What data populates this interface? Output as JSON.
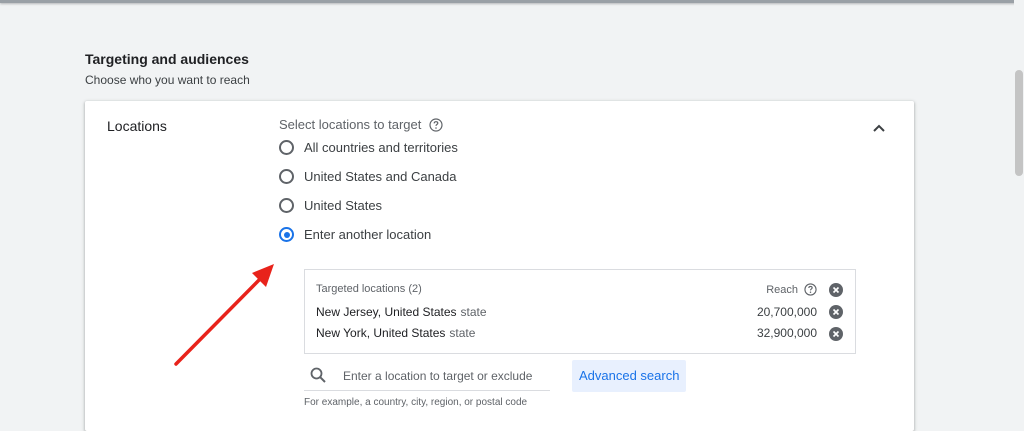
{
  "section": {
    "title": "Targeting and audiences",
    "subtitle": "Choose who you want to reach"
  },
  "locations": {
    "label": "Locations",
    "select_label": "Select locations to target",
    "options": [
      {
        "label": "All countries and territories",
        "selected": false
      },
      {
        "label": "United States and Canada",
        "selected": false
      },
      {
        "label": "United States",
        "selected": false
      },
      {
        "label": "Enter another location",
        "selected": true
      }
    ],
    "targeted": {
      "header": "Targeted locations (2)",
      "reach_header": "Reach",
      "rows": [
        {
          "name": "New Jersey, United States",
          "type": "state",
          "reach": "20,700,000"
        },
        {
          "name": "New York, United States",
          "type": "state",
          "reach": "32,900,000"
        }
      ]
    },
    "search": {
      "placeholder": "Enter a location to target or exclude",
      "hint": "For example, a country, city, region, or postal code"
    },
    "advanced_search_label": "Advanced search"
  },
  "colors": {
    "accent": "#1a73e8",
    "annotation_arrow": "#e8231b"
  },
  "icons": [
    "help-icon",
    "chevron-up-icon",
    "remove-icon",
    "search-icon"
  ]
}
